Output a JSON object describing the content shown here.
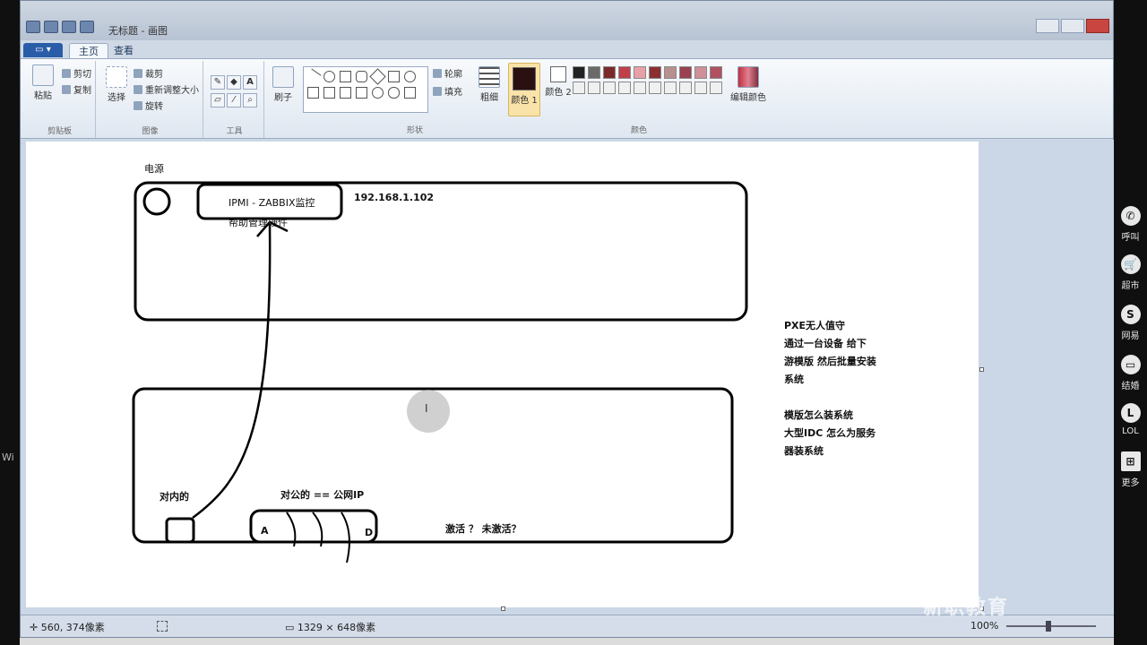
{
  "window": {
    "title": "无标题 - 画图",
    "tabs": {
      "file": "",
      "home": "主页",
      "view": "查看"
    }
  },
  "ribbon": {
    "clipboard": {
      "paste": "粘贴",
      "cut": "剪切",
      "copy": "复制",
      "group": "剪贴板"
    },
    "image": {
      "select": "选择",
      "crop": "裁剪",
      "resize": "重新调整大小",
      "rotate": "旋转",
      "group": "图像"
    },
    "tools": {
      "group": "工具"
    },
    "brushes": {
      "label": "刷子"
    },
    "shapes": {
      "outline": "轮廓",
      "fill": "填充",
      "group": "形状"
    },
    "size": {
      "label": "粗细"
    },
    "colors": {
      "color1": "颜色 1",
      "color2": "颜色 2",
      "edit": "编辑颜色",
      "group": "颜色"
    },
    "color1_value": "#2a1010",
    "color2_value": "#ffffff",
    "palette": [
      "#222222",
      "#6a6a6a",
      "#7a2a2a",
      "#c0404a",
      "#e8a0a8",
      "#8a3030",
      "#b89090",
      "#9a4050",
      "#d09098",
      "#b05060",
      "#f0f0f0",
      "#f0f0f0",
      "#f0f0f0",
      "#f0f0f0",
      "#f0f0f0",
      "#f0f0f0",
      "#f0f0f0",
      "#f0f0f0",
      "#f0f0f0",
      "#f0f0f0"
    ]
  },
  "canvas": {
    "power_label": "电源",
    "ipmi_label": "IPMI - ZABBIX监控",
    "ipmi_sub": "帮助管理硬件",
    "ip_address": "192.168.1.102",
    "internal_label": "对内的",
    "public_label": "对公的  ==  公网IP",
    "port_a": "A",
    "port_d": "D",
    "activate_label": "激活  ？  未激活？",
    "pxe_notes": [
      "PXE无人值守",
      "通过一台设备  给下",
      "游模版 然后批量安装",
      "系统"
    ],
    "idc_notes": [
      "模版怎么装系统",
      "大型IDC 怎么为服务",
      "器装系统"
    ],
    "cursor_glyph": "I"
  },
  "statusbar": {
    "position": "560, 374像素",
    "canvas_size": "1329 × 648像素",
    "zoom": "100%"
  },
  "desktop": {
    "left_text": "Wi",
    "right_items": [
      {
        "icon": "phone-icon",
        "glyph": "✆",
        "label": "呼叫"
      },
      {
        "icon": "cart-icon",
        "glyph": "🛒",
        "label": "超市"
      },
      {
        "icon": "globe-icon",
        "glyph": "S",
        "label": "网易"
      },
      {
        "icon": "chat-icon",
        "glyph": "▭",
        "label": "结婚"
      },
      {
        "icon": "lol-icon",
        "glyph": "L",
        "label": "LOL"
      },
      {
        "icon": "more-icon",
        "glyph": "⊞",
        "label": "更多"
      }
    ],
    "watermark": "新职教育"
  }
}
